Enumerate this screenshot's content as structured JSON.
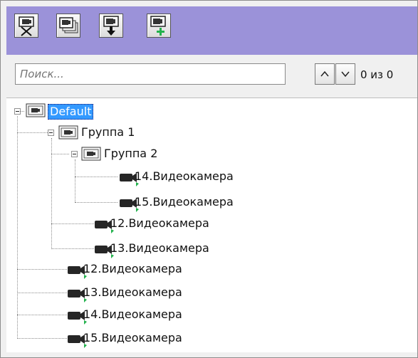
{
  "search": {
    "placeholder": "Поиск..."
  },
  "counter": "0 из 0",
  "tree": {
    "root": "Default",
    "group1": "Группа 1",
    "group2": "Группа 2",
    "g2_cam14": "14.Видеокамера",
    "g2_cam15": "15.Видеокамера",
    "g1_cam12": "12.Видеокамера",
    "g1_cam13": "13.Видеокамера",
    "cam12": "12.Видеокамера",
    "cam13": "13.Видеокамера",
    "cam14": "14.Видеокамера",
    "cam15": "15.Видеокамера"
  },
  "colors": {
    "toolbar": "#9b92d9",
    "selection": "#3399ff",
    "panel": "#f0f0f0"
  },
  "icons": [
    "remove-camera-icon",
    "copy-camera-icon",
    "import-camera-icon",
    "add-camera-icon",
    "group-folder-icon",
    "camera-icon",
    "chevron-up-icon",
    "chevron-down-icon"
  ]
}
